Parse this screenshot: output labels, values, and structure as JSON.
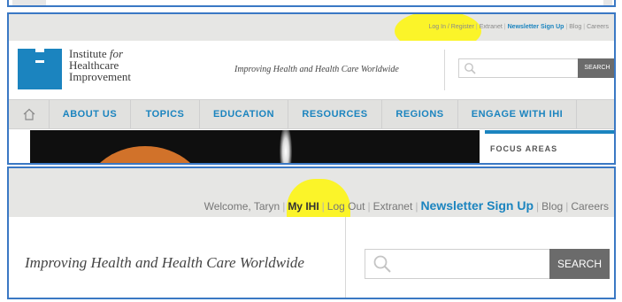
{
  "panel1": {
    "utility_links": [
      "Log In / Register",
      "Extranet",
      "Newsletter Sign Up",
      "Blog",
      "Careers"
    ],
    "logo": {
      "line1": "Institute",
      "line1_italic": "for",
      "line2": "Healthcare",
      "line3": "Improvement"
    },
    "tagline": "Improving Health and Health Care Worldwide",
    "search": {
      "placeholder": "",
      "button": "SEARCH"
    },
    "nav": {
      "home_icon": "home-icon",
      "items": [
        "ABOUT US",
        "TOPICS",
        "EDUCATION",
        "RESOURCES",
        "REGIONS",
        "ENGAGE WITH IHI"
      ]
    },
    "sidebar_title": "FOCUS AREAS"
  },
  "panel2": {
    "utility": {
      "welcome": "Welcome, Taryn",
      "my_ihi": "My IHI",
      "log_out": "Log Out",
      "extranet": "Extranet",
      "newsletter": "Newsletter Sign Up",
      "blog": "Blog",
      "careers": "Careers"
    },
    "tagline": "Improving Health and Health Care Worldwide",
    "search": {
      "placeholder": "",
      "button": "SEARCH"
    }
  },
  "colors": {
    "brand_blue": "#1b84bf",
    "highlight": "#fff600",
    "nav_bg": "#e1e1df",
    "search_button": "#6b6b6b",
    "frame": "#3a78c4"
  }
}
